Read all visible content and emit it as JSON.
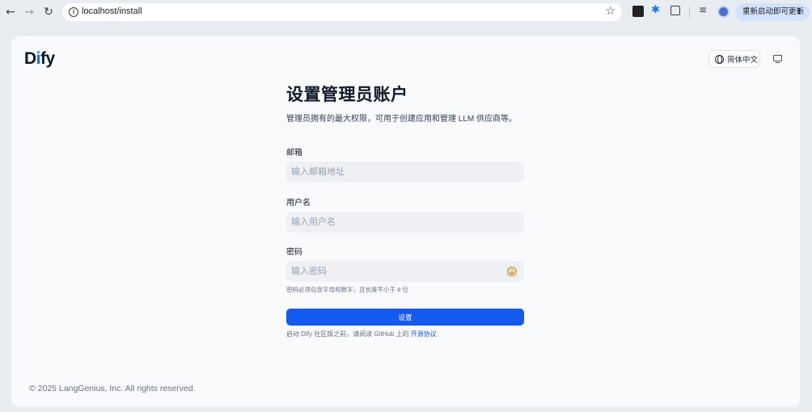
{
  "browser": {
    "url": "localhost/install",
    "update_button_label": "重新启动即可更新",
    "back_icon": "←",
    "forward_icon": "→",
    "reload_icon": "↻",
    "star_icon": "☆",
    "more_icon": "⋮"
  },
  "header": {
    "logo": {
      "part1": "D",
      "part2": "i",
      "part3": "fy"
    },
    "language_label": "简体中文"
  },
  "form": {
    "title": "设置管理员账户",
    "subtitle": "管理员拥有的最大权限，可用于创建应用和管理 LLM 供应商等。",
    "email_label": "邮箱",
    "email_placeholder": "输入邮箱地址",
    "username_label": "用户名",
    "username_placeholder": "输入用户名",
    "password_label": "密码",
    "password_placeholder": "输入密码",
    "password_hint": "密码必须包含字母和数字，且长度不小于 8 位",
    "submit_label": "设置",
    "agreement_text": "启动 Dify 社区版之前，请阅读 GitHub 上的 ",
    "agreement_link": "开源协议"
  },
  "footer": {
    "copyright": "© 2025 LangGenius, Inc. All rights reserved."
  },
  "colors": {
    "accent": "#155aef",
    "page_bg": "#f9fafb",
    "input_bg": "#eef0f3"
  }
}
